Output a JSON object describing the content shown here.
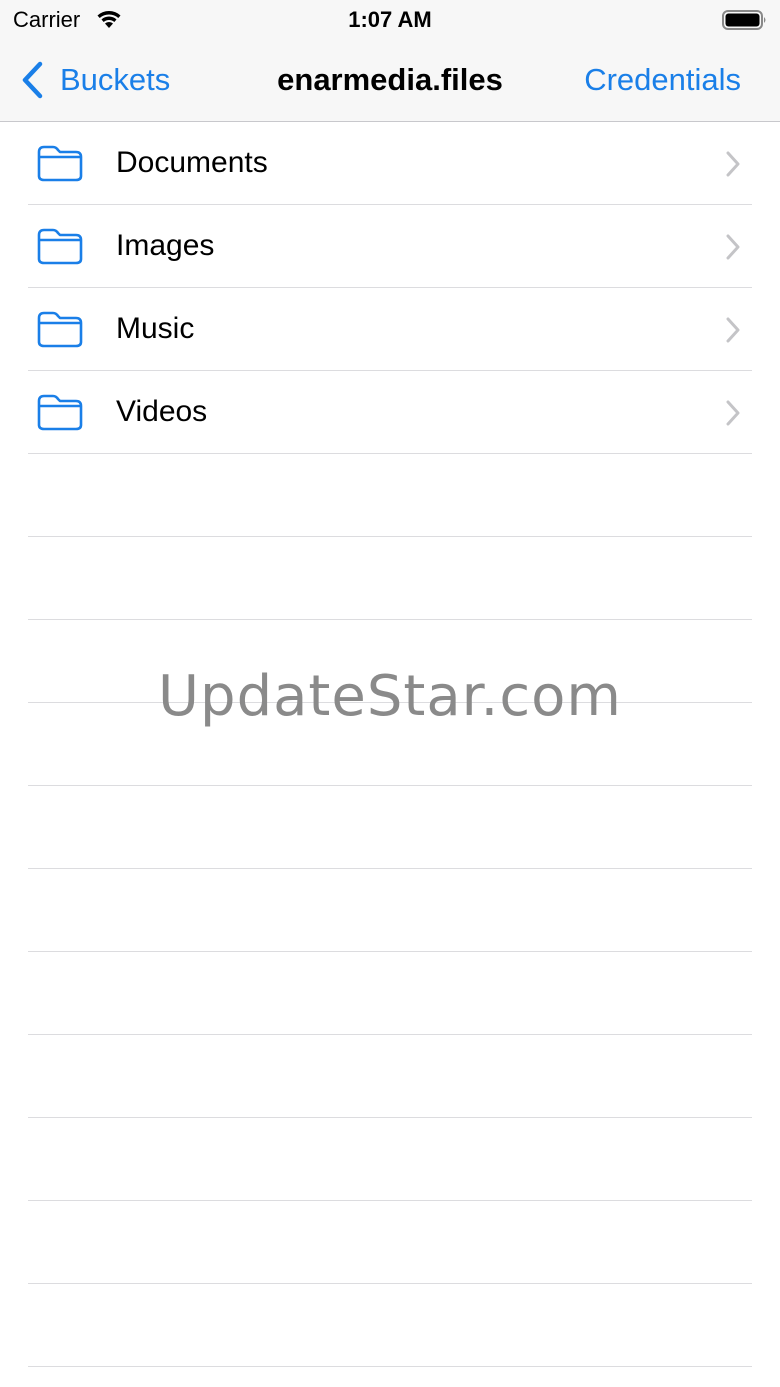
{
  "status_bar": {
    "carrier": "Carrier",
    "time": "1:07 AM"
  },
  "nav_bar": {
    "back_label": "Buckets",
    "title": "enarmedia.files",
    "right_button": "Credentials"
  },
  "folders": [
    {
      "name": "Documents",
      "icon": "folder-icon"
    },
    {
      "name": "Images",
      "icon": "folder-icon"
    },
    {
      "name": "Music",
      "icon": "folder-icon"
    },
    {
      "name": "Videos",
      "icon": "folder-icon"
    }
  ],
  "watermark": "UpdateStar.com",
  "colors": {
    "accent": "#1a7fe8",
    "separator": "#dcdcdf",
    "chevron": "#c4c4c7"
  }
}
